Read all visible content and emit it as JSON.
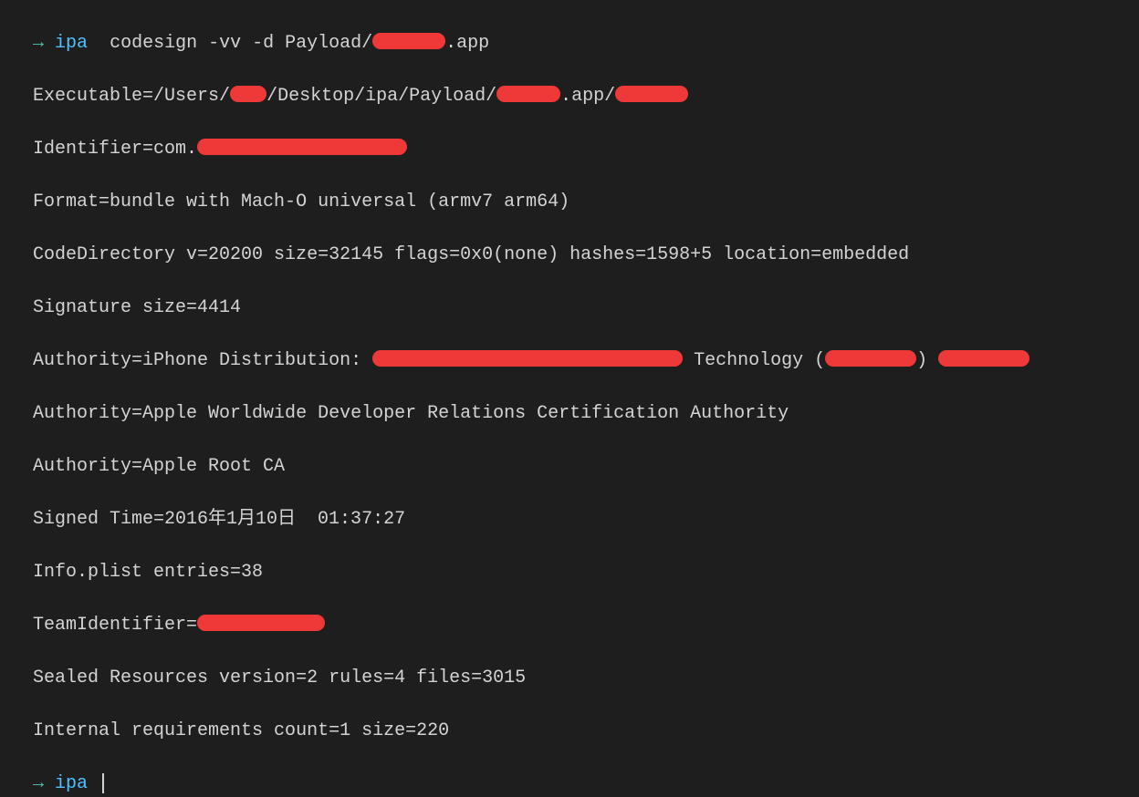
{
  "prompt": {
    "arrow": "→",
    "dir": "ipa"
  },
  "command": "codesign -vv -d Payload/",
  "command_suffix": ".app",
  "output": {
    "executable_prefix": "Executable=/Users/",
    "executable_mid": "/Desktop/ipa/Payload/",
    "executable_suffix1": ".app/",
    "identifier_prefix": "Identifier=com.",
    "format": "Format=bundle with Mach-O universal (armv7 arm64)",
    "codedirectory": "CodeDirectory v=20200 size=32145 flags=0x0(none) hashes=1598+5 location=embedded",
    "signature_size": "Signature size=4414",
    "authority1_prefix": "Authority=iPhone Distribution: ",
    "authority2": "Authority=Apple Worldwide Developer Relations Certification Authority",
    "authority3": "Authority=Apple Root CA",
    "signed_time": "Signed Time=2016年1月10日  01:37:27",
    "infoplist": "Info.plist entries=38",
    "teamid_prefix": "TeamIdentifier=",
    "sealed": "Sealed Resources version=2 rules=4 files=3015",
    "internal": "Internal requirements count=1 size=220"
  }
}
